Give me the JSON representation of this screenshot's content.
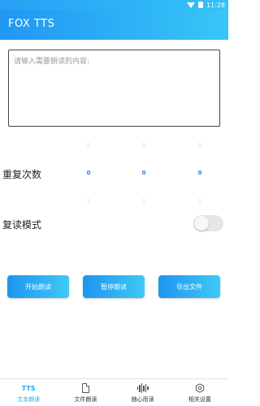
{
  "status_bar": {
    "time": "11:28"
  },
  "app": {
    "title": "FOX TTS"
  },
  "text_input": {
    "placeholder": "请输入需要朗读的内容:"
  },
  "repeat": {
    "label": "重复次数",
    "columns": [
      {
        "above": "9",
        "value": "0",
        "below": "1"
      },
      {
        "above": "9",
        "value": "0",
        "below": "1"
      },
      {
        "above": "9",
        "value": "0",
        "below": "1"
      }
    ]
  },
  "repeat_mode": {
    "label": "复读模式",
    "enabled": false
  },
  "buttons": {
    "start": "开始朗读",
    "pause": "暂停朗读",
    "export": "导出文件"
  },
  "tabs": [
    {
      "icon": "tts-icon",
      "icon_text": "TTS",
      "label": "文本朗读",
      "active": true
    },
    {
      "icon": "document-icon",
      "label": "文件朗读",
      "active": false
    },
    {
      "icon": "waveform-icon",
      "label": "随心而读",
      "active": false
    },
    {
      "icon": "settings-hex-icon",
      "label": "相关设置",
      "active": false
    }
  ],
  "colors": {
    "accent": "#2aa6f5",
    "appbar_start": "#2196f3",
    "appbar_end": "#38c6f7",
    "picker_active": "#2a86d6"
  }
}
